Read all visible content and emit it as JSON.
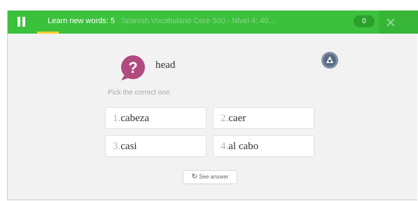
{
  "topbar": {
    "title": "Learn new words: 5",
    "course": "Spanish Vocabulario Core 500 - Nivel 4: 40…",
    "counter": "0",
    "progress": 0.06,
    "colors": {
      "bar": "#3cc13c",
      "progress": "#f4d22a"
    }
  },
  "question": {
    "prompt": "head",
    "instruction": "Pick the correct one",
    "icon": "question-mark-bubble-icon",
    "audio_icon": "audio-icon"
  },
  "options": [
    {
      "num": "1.",
      "text": "cabeza"
    },
    {
      "num": "2.",
      "text": "caer"
    },
    {
      "num": "3.",
      "text": "casi"
    },
    {
      "num": "4.",
      "text": "al cabo"
    }
  ],
  "see_answer": {
    "label": "See answer",
    "icon": "refresh-icon"
  }
}
